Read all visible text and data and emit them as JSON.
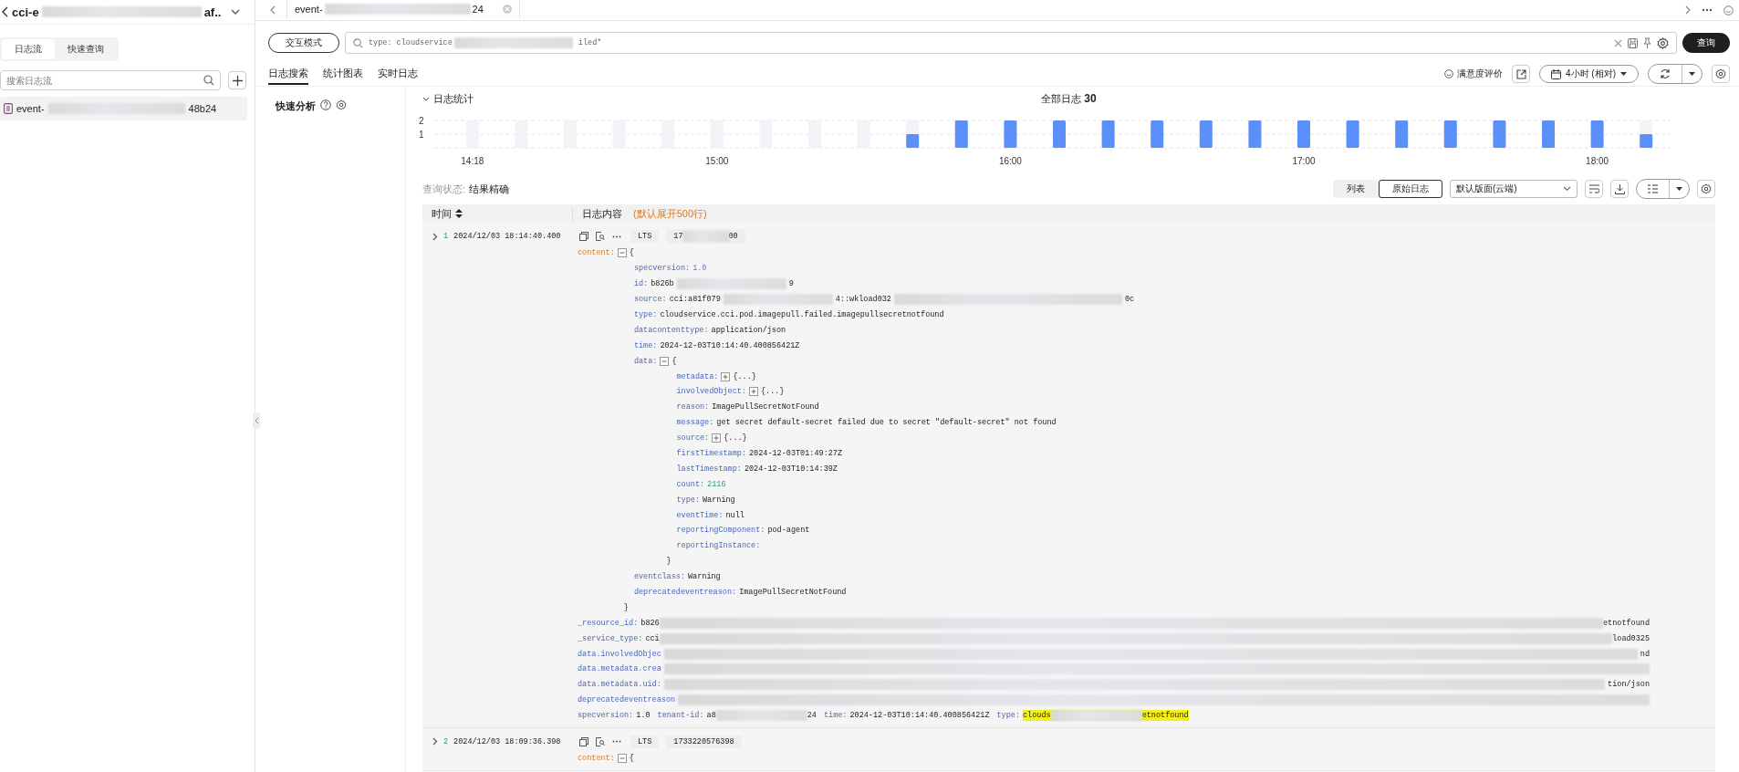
{
  "sidebar": {
    "title": {
      "head": "cci-e",
      "tail": "af.."
    },
    "tabs": [
      {
        "label": "日志流",
        "selected": true
      },
      {
        "label": "快速查询",
        "selected": false
      }
    ],
    "search": {
      "placeholder": "搜索日志流"
    },
    "streams": [
      {
        "head": "event-",
        "tail": "48b24",
        "selected": true
      }
    ]
  },
  "tab_bar": {
    "tabs": [
      {
        "head": "event-",
        "tail": "24",
        "selected": true
      }
    ]
  },
  "query": {
    "mode_button": "交互模式",
    "head": "type: cloudservice",
    "tail": "iled*",
    "submit": "查询"
  },
  "view_tabs": [
    {
      "label": "日志搜索",
      "selected": true
    },
    {
      "label": "统计图表",
      "selected": false
    },
    {
      "label": "实时日志",
      "selected": false
    }
  ],
  "toolbar": {
    "feedback": "满意度评价",
    "time_range": "4小时 (相对)"
  },
  "quick_analysis": {
    "title": "快速分析"
  },
  "histogram": {
    "title": "日志统计",
    "expanded": true,
    "total_label": "全部日志",
    "total": "30",
    "chart_data": {
      "type": "bar",
      "categories": [
        "14:18",
        null,
        null,
        null,
        null,
        "15:00",
        null,
        null,
        null,
        null,
        null,
        "16:00",
        null,
        null,
        null,
        null,
        null,
        "17:00",
        null,
        null,
        null,
        null,
        null,
        "18:00",
        null
      ],
      "ylim": [
        0,
        2
      ],
      "values": [
        0,
        0,
        0,
        0,
        0,
        0,
        0,
        0,
        0,
        1,
        2,
        2,
        2,
        2,
        2,
        2,
        2,
        2,
        2,
        2,
        2,
        2,
        2,
        2,
        1
      ],
      "yticks": [
        1,
        2
      ]
    }
  },
  "query_status": {
    "label": "查询状态:",
    "value": "结果精确"
  },
  "view_mode": [
    {
      "label": "列表",
      "selected": false
    },
    {
      "label": "原始日志",
      "selected": true
    }
  ],
  "layout_select": "默认版面(云端)",
  "table": {
    "columns": [
      {
        "label": "时间"
      },
      {
        "label": "日志内容",
        "note": "(默认展开500行)"
      }
    ],
    "rows": [
      {
        "index": "1",
        "time": "2024/12/03 18:14:40.400",
        "source": "LTS",
        "id_segments": [
          "17",
          "00"
        ],
        "content": {
          "key": "content:",
          "kind": "object",
          "expanded": true,
          "open": "{",
          "close": "}",
          "children": [
            {
              "key": "specversion:",
              "kind": "float",
              "segments": [
                "1.0"
              ]
            },
            {
              "key": "id:",
              "kind": "field",
              "segments": [
                "b826b",
                "9"
              ]
            },
            {
              "key": "source:",
              "kind": "field",
              "segments": [
                "cci:a81f079",
                "4::wkload032",
                "0c"
              ]
            },
            {
              "key": "type:",
              "kind": "field",
              "segments": [
                "cloudservice.cci.pod.imagepull.failed.imagepullsecretnotfound"
              ]
            },
            {
              "key": "datacontenttype:",
              "kind": "field",
              "segments": [
                "application/json"
              ]
            },
            {
              "key": "time:",
              "kind": "field",
              "segments": [
                "2024-12-03T10:14:40.400856421Z"
              ]
            },
            {
              "key": "data:",
              "kind": "object",
              "expanded": true,
              "open": "{",
              "close": "}",
              "children": [
                {
                  "key": "metadata:",
                  "kind": "object",
                  "expanded": false,
                  "preview": "{...}"
                },
                {
                  "key": "involvedObject:",
                  "kind": "object",
                  "expanded": false,
                  "preview": "{...}"
                },
                {
                  "key": "reason:",
                  "kind": "field",
                  "segments": [
                    "ImagePullSecretNotFound"
                  ]
                },
                {
                  "key": "message:",
                  "kind": "field",
                  "segments": [
                    "get secret default-secret failed due to secret \"default-secret\" not found"
                  ]
                },
                {
                  "key": "source:",
                  "kind": "object",
                  "expanded": false,
                  "preview": "{...}"
                },
                {
                  "key": "firstTimestamp:",
                  "kind": "field",
                  "segments": [
                    "2024-12-03T01:49:27Z"
                  ]
                },
                {
                  "key": "lastTimestamp:",
                  "kind": "field",
                  "segments": [
                    "2024-12-03T10:14:39Z"
                  ]
                },
                {
                  "key": "count:",
                  "kind": "int",
                  "segments": [
                    "2116"
                  ]
                },
                {
                  "key": "type:",
                  "kind": "field",
                  "segments": [
                    "Warning"
                  ]
                },
                {
                  "key": "eventTime:",
                  "kind": "field",
                  "segments": [
                    "null"
                  ]
                },
                {
                  "key": "reportingComponent:",
                  "kind": "field",
                  "segments": [
                    "pod-agent"
                  ]
                },
                {
                  "key": "reportingInstance:",
                  "kind": "field"
                }
              ]
            },
            {
              "key": "eventclass:",
              "kind": "field",
              "segments": [
                "Warning"
              ]
            },
            {
              "key": "deprecatedeventreason:",
              "kind": "field",
              "segments": [
                "ImagePullSecretNotFound"
              ]
            }
          ]
        },
        "flat_lines": [
          {
            "pairs": [
              {
                "key": "_resource_id:",
                "segments": [
                  "b826",
                  "etnotfound"
                ]
              }
            ]
          },
          {
            "pairs": [
              {
                "key": "_service_type:",
                "segments": [
                  "cci",
                  "load0325"
                ]
              }
            ]
          },
          {
            "pairs": [
              {
                "key": "data.involvedObjec",
                "lead_blur": true,
                "segments": [
                  "nd"
                ]
              }
            ]
          },
          {
            "pairs": [
              {
                "key": "data.metadata.crea",
                "lead_blur": true
              }
            ]
          },
          {
            "pairs": [
              {
                "key": "data.metadata.uid:",
                "lead_blur": true,
                "segments": [
                  "tion/json"
                ]
              }
            ]
          },
          {
            "pairs": [
              {
                "key": "deprecatedeventreason",
                "lead_blur": true
              }
            ]
          },
          {
            "pairs": [
              {
                "key": "specversion:",
                "segments": [
                  "1.0"
                ]
              },
              {
                "key": "tenant-id:",
                "segments": [
                  "a8",
                  "24"
                ]
              },
              {
                "key": "time:",
                "segments": [
                  "2024-12-03T10:14:40.400856421Z"
                ]
              },
              {
                "key": "type:",
                "segments": [
                  "clouds",
                  "etnotfound"
                ],
                "highlight": true
              }
            ]
          }
        ]
      },
      {
        "index": "2",
        "time": "2024/12/03 18:09:36.398",
        "source": "LTS",
        "id_segments": [
          "1733220576398"
        ],
        "content": {
          "key": "content:",
          "kind": "object",
          "expanded": true,
          "open": "{"
        }
      }
    ]
  }
}
